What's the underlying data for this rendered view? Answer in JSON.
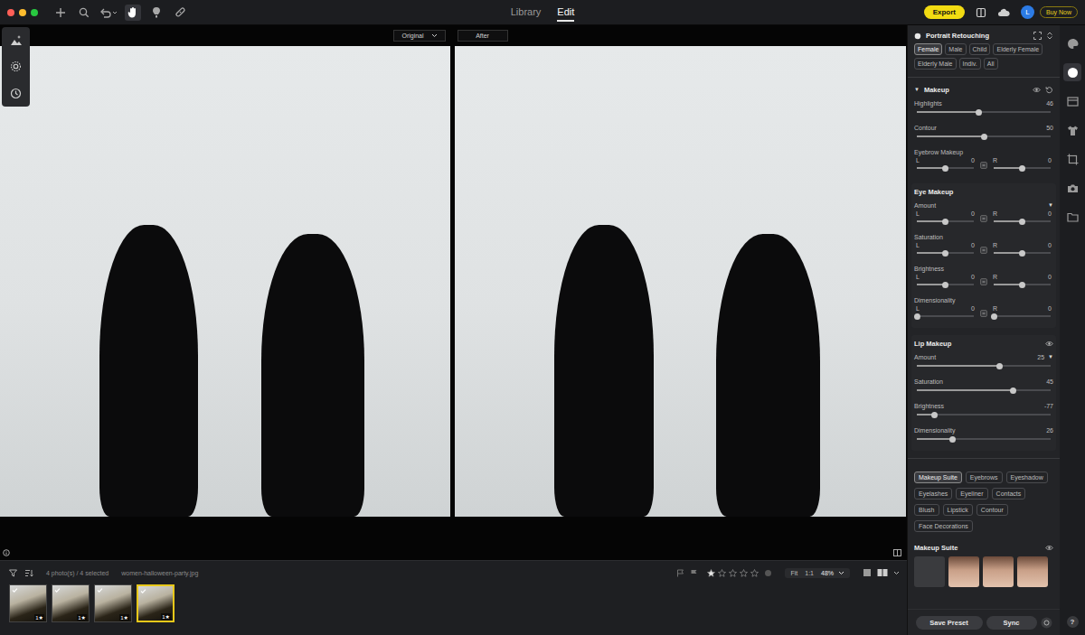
{
  "window": {
    "traffic_lights": [
      {
        "color": "#ff5f57"
      },
      {
        "color": "#febc2e"
      },
      {
        "color": "#28c840"
      }
    ]
  },
  "toolbar": {
    "tools": [
      {
        "selected": false
      },
      {
        "selected": false
      },
      {
        "selected": false
      },
      {
        "selected": true
      },
      {
        "selected": false
      },
      {
        "selected": false
      }
    ],
    "nav_tabs": [
      {
        "label": "Library",
        "selected": false
      },
      {
        "label": "Edit",
        "selected": true
      }
    ],
    "export_button": "Export",
    "avatar": "L",
    "buy_button": "Buy Now"
  },
  "viewer": {
    "compare": [
      {
        "label": "Original",
        "dropdown": true
      },
      {
        "label": "After",
        "dropdown": false
      }
    ]
  },
  "filmstrip": {
    "count": "4 photo(s) / 4 selected",
    "filename": "women-halloween-party.jpg",
    "thumbnails": [
      {
        "selected": false,
        "checked": true,
        "badge": "1★"
      },
      {
        "selected": false,
        "checked": true,
        "badge": "1★"
      },
      {
        "selected": false,
        "checked": true,
        "badge": "1★"
      },
      {
        "selected": true,
        "checked": true,
        "badge": "1★"
      }
    ],
    "rating": {
      "stars": 1
    },
    "zoom": {
      "options": [
        "Fit",
        "1:1"
      ],
      "value": "48%"
    }
  },
  "panel": {
    "title": "Portrait Retouching",
    "subjects": [
      {
        "label": "Female",
        "selected": true
      },
      {
        "label": "Male",
        "selected": false
      },
      {
        "label": "Child",
        "selected": false
      },
      {
        "label": "Elderly Female",
        "selected": false
      },
      {
        "label": "Elderly Male",
        "selected": false
      },
      {
        "label": "Indiv.",
        "selected": false
      },
      {
        "label": "All",
        "selected": false
      }
    ],
    "sections": [
      {
        "kind": "main",
        "title": "Makeup",
        "toggle": "▼",
        "rows": [
          {
            "kind": "single",
            "label": "Highlights",
            "value": "46",
            "level": 0.46
          },
          {
            "kind": "single",
            "label": "Contour",
            "value": "50",
            "level": 0.5
          },
          {
            "kind": "pair",
            "label": "Eyebrow Makeup",
            "left": {
              "label": "L",
              "value": "0",
              "level": 0.5
            },
            "right": {
              "label": "R",
              "value": "0",
              "level": 0.5
            }
          }
        ]
      },
      {
        "kind": "plain",
        "title": "Eye Makeup",
        "rows": [
          {
            "kind": "pair",
            "label": "Amount",
            "menu": "▼",
            "left": {
              "label": "L",
              "value": "0",
              "level": 0.5
            },
            "right": {
              "label": "R",
              "value": "0",
              "level": 0.5
            }
          },
          {
            "kind": "pair",
            "label": "Saturation",
            "left": {
              "label": "L",
              "value": "0",
              "level": 0.5
            },
            "right": {
              "label": "R",
              "value": "0",
              "level": 0.5
            }
          },
          {
            "kind": "pair",
            "label": "Brightness",
            "left": {
              "label": "L",
              "value": "0",
              "level": 0.5
            },
            "right": {
              "label": "R",
              "value": "0",
              "level": 0.5
            }
          },
          {
            "kind": "pair",
            "label": "Dimensionality",
            "left": {
              "label": "L",
              "value": "0",
              "level": 0
            },
            "right": {
              "label": "R",
              "value": "0",
              "level": 0
            }
          }
        ]
      },
      {
        "kind": "eye",
        "title": "Lip Makeup",
        "rows": [
          {
            "kind": "single",
            "label": "Amount",
            "value": "25",
            "menu": "▼",
            "level": 0.62
          },
          {
            "kind": "single",
            "label": "Saturation",
            "value": "45",
            "level": 0.72
          },
          {
            "kind": "single",
            "label": "Brightness",
            "value": "-77",
            "level": 0.13
          },
          {
            "kind": "single",
            "label": "Dimensionality",
            "value": "26",
            "level": 0.27
          }
        ]
      }
    ],
    "categories": [
      {
        "label": "Makeup Suite",
        "selected": true
      },
      {
        "label": "Eyebrows",
        "selected": false
      },
      {
        "label": "Eyeshadow",
        "selected": false
      },
      {
        "label": "Eyelashes",
        "selected": false
      },
      {
        "label": "Eyeliner",
        "selected": false
      },
      {
        "label": "Contacts",
        "selected": false
      },
      {
        "label": "Blush",
        "selected": false
      },
      {
        "label": "Lipstick",
        "selected": false
      },
      {
        "label": "Contour",
        "selected": false
      },
      {
        "label": "Face Decorations",
        "selected": false
      }
    ],
    "suite": {
      "title": "Makeup Suite",
      "presets": [
        {
          "kind": "none"
        },
        {
          "kind": "photo"
        },
        {
          "kind": "photo"
        },
        {
          "kind": "photo"
        }
      ]
    },
    "buttons": [
      "Save Preset",
      "Sync"
    ]
  },
  "sidebar": {
    "tools": [
      {
        "selected": false
      },
      {
        "selected": true
      },
      {
        "selected": false
      },
      {
        "selected": false
      },
      {
        "selected": false
      },
      {
        "selected": false
      },
      {
        "selected": false
      }
    ],
    "help": "?"
  }
}
